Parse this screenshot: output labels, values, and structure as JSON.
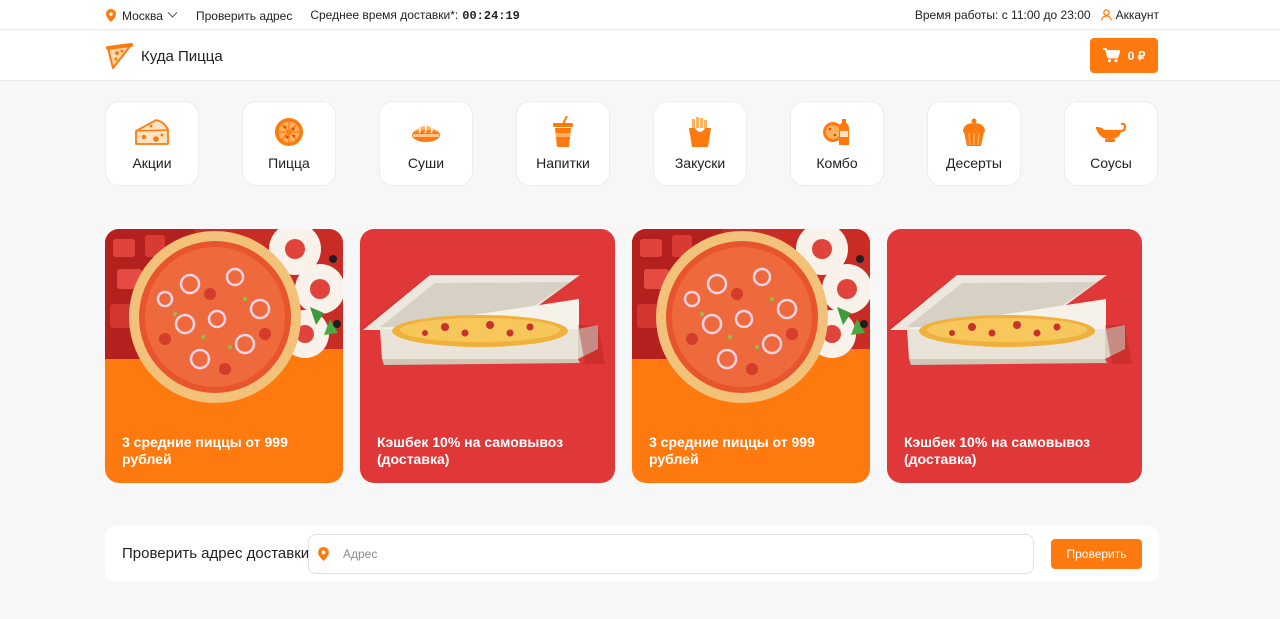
{
  "colors": {
    "accent": "#ff7a0e",
    "promo_red": "#e03838",
    "background": "#f7f7f7"
  },
  "topbar": {
    "city": "Москва",
    "check_address": "Проверить адрес",
    "delivery_label": "Среднее время доставки*:",
    "delivery_time": "00:24:19",
    "work_hours": "Время работы: с 11:00 до 23:00",
    "account": "Аккаунт",
    "icons": {
      "city": "map-pin-icon",
      "account": "user-icon"
    }
  },
  "header": {
    "logo_text": "Куда Пицца",
    "logo_icon": "pizza-slice-icon",
    "cart_total": "0 ₽",
    "cart_icon": "cart-icon"
  },
  "categories": [
    {
      "label": "Акции",
      "icon": "cheese-icon"
    },
    {
      "label": "Пицца",
      "icon": "pizza-icon"
    },
    {
      "label": "Суши",
      "icon": "sushi-icon"
    },
    {
      "label": "Напитки",
      "icon": "drink-icon"
    },
    {
      "label": "Закуски",
      "icon": "fries-icon"
    },
    {
      "label": "Комбо",
      "icon": "combo-icon"
    },
    {
      "label": "Десерты",
      "icon": "cupcake-icon"
    },
    {
      "label": "Соусы",
      "icon": "sauce-boat-icon"
    }
  ],
  "promos": [
    {
      "text": "3 средние пиццы от 999 рублей",
      "style": "orange",
      "image": "pizza-top-view"
    },
    {
      "text": "Кэшбек 10% на самовывоз (доставка)",
      "style": "red",
      "image": "pizza-box"
    },
    {
      "text": "3 средние пиццы от 999 рублей",
      "style": "orange",
      "image": "pizza-top-view"
    },
    {
      "text": "Кэшбек 10% на самовывоз (доставка)",
      "style": "red",
      "image": "pizza-box"
    }
  ],
  "address_check": {
    "title": "Проверить адрес доставки",
    "placeholder": "Адрес",
    "value": "",
    "button": "Проверить",
    "icon": "map-pin-icon"
  }
}
